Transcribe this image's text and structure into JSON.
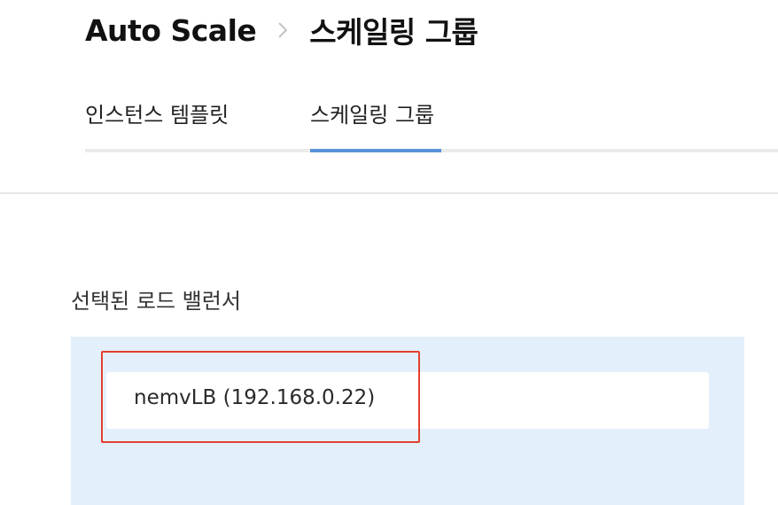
{
  "breadcrumb": {
    "service": "Auto Scale",
    "separator_icon": "chevron-right-icon",
    "current": "스케일링 그룹"
  },
  "tabs": [
    {
      "label": "인스턴스 템플릿",
      "active": false
    },
    {
      "label": "스케일링 그룹",
      "active": true
    }
  ],
  "load_balancer": {
    "section_label": "선택된 로드 밸런서",
    "selected_value": "nemvLB (192.168.0.22)"
  },
  "colors": {
    "tab_active": "#5a93d8",
    "panel_background": "#e4effc",
    "highlight": "#e2402f"
  }
}
